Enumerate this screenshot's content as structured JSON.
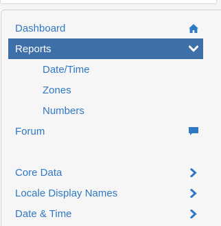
{
  "nav": {
    "dashboard": {
      "label": "Dashboard",
      "icon": "home-icon"
    },
    "reports": {
      "label": "Reports",
      "icon": "chevron-down-icon",
      "children": [
        "Date/Time",
        "Zones",
        "Numbers"
      ]
    },
    "forum": {
      "label": "Forum",
      "icon": "comment-icon"
    },
    "sections": [
      {
        "label": "Core Data",
        "icon": "chevron-right-icon"
      },
      {
        "label": "Locale Display Names",
        "icon": "chevron-right-icon"
      },
      {
        "label": "Date & Time",
        "icon": "chevron-right-icon"
      }
    ]
  },
  "colors": {
    "link": "#2f78c4",
    "active_bg": "#3f6fa8",
    "active_text": "#ffffff",
    "sidebar_bg": "#f6f6f6"
  }
}
